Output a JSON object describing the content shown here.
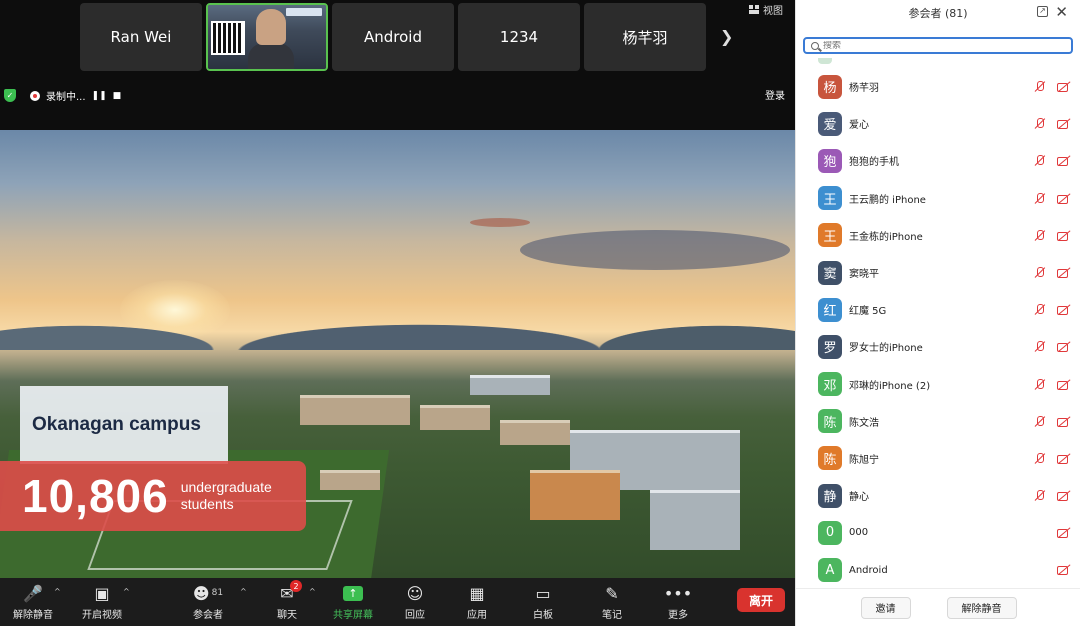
{
  "thumbnails": [
    {
      "label": "Ran Wei",
      "video": false
    },
    {
      "label": "",
      "video": true
    },
    {
      "label": "Android",
      "video": false
    },
    {
      "label": "1234",
      "video": false
    },
    {
      "label": "杨芊羽",
      "video": false
    }
  ],
  "topbar": {
    "view_label": "视图",
    "login_label": "登录",
    "recording_label": "录制中..."
  },
  "slide": {
    "campus_title": "Okanagan campus",
    "stat_number": "10,806",
    "stat_label_1": "undergraduate",
    "stat_label_2": "students"
  },
  "toolbar": {
    "unmute": "解除静音",
    "start_video": "开启视频",
    "participants": "参会者",
    "participants_count": "81",
    "chat": "聊天",
    "chat_badge": "2",
    "share": "共享屏幕",
    "reactions": "回应",
    "apps": "应用",
    "whiteboard": "白板",
    "notes": "笔记",
    "more": "更多",
    "leave": "离开"
  },
  "panel": {
    "title": "参会者 (81)",
    "search_placeholder": "搜索",
    "invite": "邀请",
    "unmute_all": "解除静音",
    "participants": [
      {
        "initial": "杨",
        "name": "杨芊羽",
        "color": "#c8553d",
        "mic_off": true
      },
      {
        "initial": "爱",
        "name": "爱心",
        "color": "#4a5a78",
        "mic_off": true
      },
      {
        "initial": "狍",
        "name": "狍狍的手机",
        "color": "#9b59b6",
        "mic_off": true
      },
      {
        "initial": "王",
        "name": "王云鹏的 iPhone",
        "color": "#3d8fd0",
        "mic_off": true
      },
      {
        "initial": "王",
        "name": "王金栋的iPhone",
        "color": "#e07a2a",
        "mic_off": true
      },
      {
        "initial": "窦",
        "name": "窦晓平",
        "color": "#3f5068",
        "mic_off": true
      },
      {
        "initial": "红",
        "name": "红魔 5G",
        "color": "#3d8fd0",
        "mic_off": true
      },
      {
        "initial": "罗",
        "name": "罗女士的iPhone",
        "color": "#3f5068",
        "mic_off": true
      },
      {
        "initial": "邓",
        "name": "邓琳的iPhone (2)",
        "color": "#4cb65f",
        "mic_off": true
      },
      {
        "initial": "陈",
        "name": "陈文浩",
        "color": "#4cb65f",
        "mic_off": true
      },
      {
        "initial": "陈",
        "name": "陈旭宁",
        "color": "#e07a2a",
        "mic_off": true
      },
      {
        "initial": "静",
        "name": "静心",
        "color": "#3f5068",
        "mic_off": true
      },
      {
        "initial": "0",
        "name": "000",
        "color": "#4cb65f",
        "mic_off": false
      },
      {
        "initial": "A",
        "name": "Android",
        "color": "#4cb65f",
        "mic_off": false
      }
    ]
  }
}
